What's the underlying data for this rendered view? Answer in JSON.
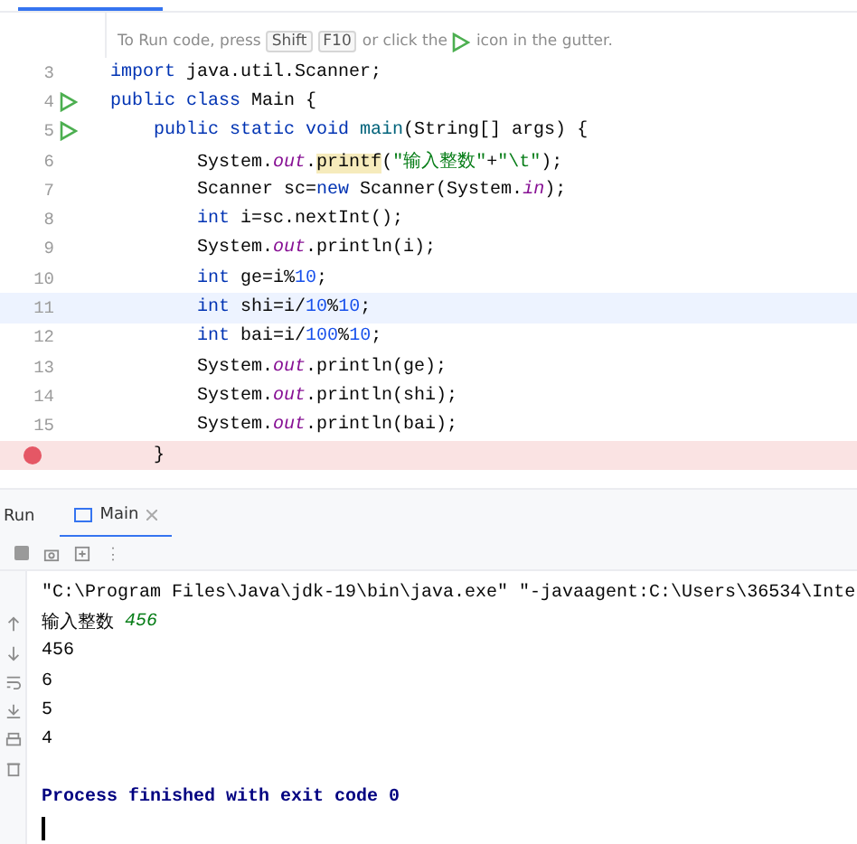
{
  "hint": {
    "before": "To Run code, press",
    "keys": [
      "Shift",
      "F10"
    ],
    "after": "or click the",
    "after2": "icon in the gutter."
  },
  "code_lines": [
    {
      "number": "3",
      "run_button": false,
      "current": false,
      "breakpoint": false,
      "tokens": [
        {
          "t": "import",
          "kind": "kw"
        },
        {
          "t": " java.util.Scanner;",
          "kind": "plain"
        }
      ]
    },
    {
      "number": "4",
      "run_button": true,
      "current": false,
      "breakpoint": false,
      "tokens": [
        {
          "t": "public class",
          "kind": "kw"
        },
        {
          "t": " Main {",
          "kind": "plain"
        }
      ]
    },
    {
      "number": "5",
      "run_button": true,
      "current": false,
      "breakpoint": false,
      "tokens": [
        {
          "t": "    public static void",
          "kind": "kw"
        },
        {
          "t": " main",
          "kind": "method"
        },
        {
          "t": "(String[] args) {",
          "kind": "plain"
        }
      ]
    },
    {
      "number": "6",
      "run_button": false,
      "current": false,
      "breakpoint": false,
      "tokens": [
        {
          "t": "        System.",
          "kind": "plain"
        },
        {
          "t": "out",
          "kind": "field"
        },
        {
          "t": ".",
          "kind": "plain"
        },
        {
          "t": "printf",
          "kind": "warn"
        },
        {
          "t": "(",
          "kind": "plain"
        },
        {
          "t": "\"输入整数\"",
          "kind": "str"
        },
        {
          "t": "+",
          "kind": "plain"
        },
        {
          "t": "\"\\t\"",
          "kind": "str"
        },
        {
          "t": ");",
          "kind": "plain"
        }
      ]
    },
    {
      "number": "7",
      "run_button": false,
      "current": false,
      "breakpoint": false,
      "tokens": [
        {
          "t": "        Scanner sc=",
          "kind": "plain"
        },
        {
          "t": "new",
          "kind": "kw"
        },
        {
          "t": " Scanner(System.",
          "kind": "plain"
        },
        {
          "t": "in",
          "kind": "field"
        },
        {
          "t": ");",
          "kind": "plain"
        }
      ]
    },
    {
      "number": "8",
      "run_button": false,
      "current": false,
      "breakpoint": false,
      "tokens": [
        {
          "t": "        int",
          "kind": "kw"
        },
        {
          "t": " i=sc.nextInt();",
          "kind": "plain"
        }
      ]
    },
    {
      "number": "9",
      "run_button": false,
      "current": false,
      "breakpoint": false,
      "tokens": [
        {
          "t": "        System.",
          "kind": "plain"
        },
        {
          "t": "out",
          "kind": "field"
        },
        {
          "t": ".println(i);",
          "kind": "plain"
        }
      ]
    },
    {
      "number": "10",
      "run_button": false,
      "current": false,
      "breakpoint": false,
      "tokens": [
        {
          "t": "        int",
          "kind": "kw"
        },
        {
          "t": " ge=i%",
          "kind": "plain"
        },
        {
          "t": "10",
          "kind": "num"
        },
        {
          "t": ";",
          "kind": "plain"
        }
      ]
    },
    {
      "number": "11",
      "run_button": false,
      "current": true,
      "breakpoint": false,
      "tokens": [
        {
          "t": "        int",
          "kind": "kw"
        },
        {
          "t": " shi=i/",
          "kind": "plain"
        },
        {
          "t": "10",
          "kind": "num"
        },
        {
          "t": "%",
          "kind": "plain"
        },
        {
          "t": "10",
          "kind": "num"
        },
        {
          "t": ";",
          "kind": "plain"
        }
      ]
    },
    {
      "number": "12",
      "run_button": false,
      "current": false,
      "breakpoint": false,
      "tokens": [
        {
          "t": "        int",
          "kind": "kw"
        },
        {
          "t": " bai=i/",
          "kind": "plain"
        },
        {
          "t": "100",
          "kind": "num"
        },
        {
          "t": "%",
          "kind": "plain"
        },
        {
          "t": "10",
          "kind": "num"
        },
        {
          "t": ";",
          "kind": "plain"
        }
      ]
    },
    {
      "number": "13",
      "run_button": false,
      "current": false,
      "breakpoint": false,
      "tokens": [
        {
          "t": "        System.",
          "kind": "plain"
        },
        {
          "t": "out",
          "kind": "field"
        },
        {
          "t": ".println(ge);",
          "kind": "plain"
        }
      ]
    },
    {
      "number": "14",
      "run_button": false,
      "current": false,
      "breakpoint": false,
      "tokens": [
        {
          "t": "        System.",
          "kind": "plain"
        },
        {
          "t": "out",
          "kind": "field"
        },
        {
          "t": ".println(shi);",
          "kind": "plain"
        }
      ]
    },
    {
      "number": "15",
      "run_button": false,
      "current": false,
      "breakpoint": false,
      "tokens": [
        {
          "t": "        System.",
          "kind": "plain"
        },
        {
          "t": "out",
          "kind": "field"
        },
        {
          "t": ".println(bai);",
          "kind": "plain"
        }
      ]
    },
    {
      "run_button": false,
      "current": false,
      "breakpoint": true,
      "tokens": [
        {
          "t": "    }",
          "kind": "plain"
        }
      ]
    }
  ],
  "run_panel": {
    "title": "Run",
    "tabs": [
      {
        "label": "Main",
        "selected": true
      }
    ]
  },
  "console_lines": [
    {
      "tokens": [
        {
          "t": "\"C:\\Program Files\\Java\\jdk-19\\bin\\java.exe\" \"-javaagent:C:\\Users\\36534\\Inte",
          "kind": "plain"
        }
      ]
    },
    {
      "tokens": [
        {
          "t": "输入整数 ",
          "kind": "plain"
        },
        {
          "t": "456",
          "kind": "input"
        }
      ]
    },
    {
      "tokens": [
        {
          "t": "456",
          "kind": "plain"
        }
      ]
    },
    {
      "tokens": [
        {
          "t": "6",
          "kind": "plain"
        }
      ]
    },
    {
      "tokens": [
        {
          "t": "5",
          "kind": "plain"
        }
      ]
    },
    {
      "tokens": [
        {
          "t": "4",
          "kind": "plain"
        }
      ]
    },
    {
      "tokens": [
        {
          "t": "Process finished with exit code 0",
          "kind": "exit"
        }
      ]
    }
  ]
}
